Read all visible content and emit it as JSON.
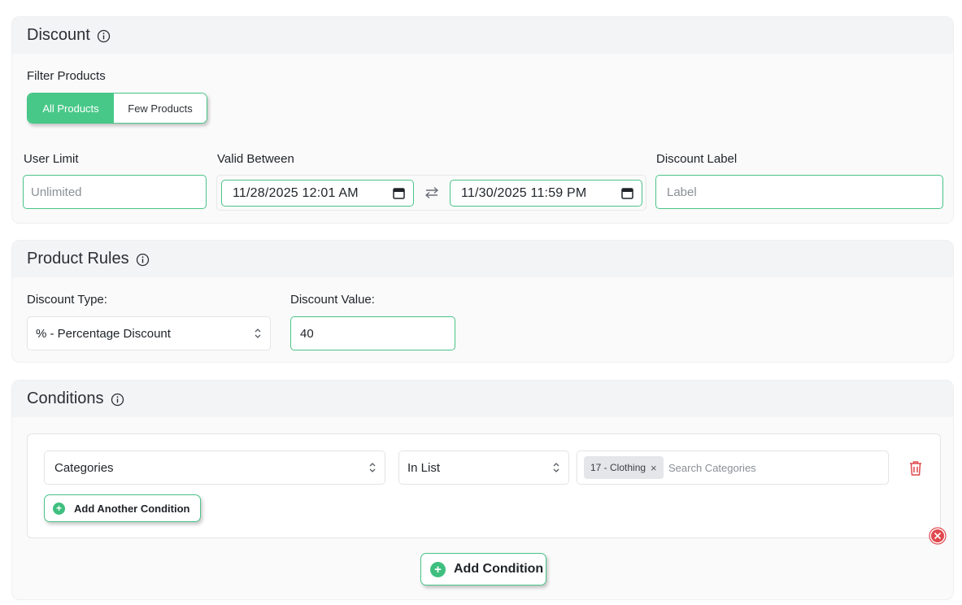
{
  "discount": {
    "title": "Discount",
    "filter_label": "Filter Products",
    "filter_options": [
      "All Products",
      "Few Products"
    ],
    "user_limit_label": "User Limit",
    "user_limit_placeholder": "Unlimited",
    "valid_between_label": "Valid Between",
    "start_datetime": "11/28/2025 12:01 AM",
    "end_datetime": "11/30/2025 11:59 PM",
    "discount_label_label": "Discount Label",
    "discount_label_placeholder": "Label"
  },
  "product_rules": {
    "title": "Product Rules",
    "discount_type_label": "Discount Type:",
    "discount_type_value": "% - Percentage Discount",
    "discount_value_label": "Discount Value:",
    "discount_value": "40"
  },
  "conditions": {
    "title": "Conditions",
    "field_value": "Categories",
    "operator_value": "In List",
    "tags": [
      "17 - Clothing"
    ],
    "search_placeholder": "Search Categories",
    "add_another_label": "Add Another Condition",
    "add_condition_label": "Add Condition"
  },
  "colors": {
    "accent": "#48c888",
    "danger": "#e0484e"
  },
  "icons": [
    "info-icon",
    "calendar-icon",
    "swap-icon",
    "chevron-updown-icon",
    "trash-icon",
    "plus-circle-icon",
    "close-circle-icon"
  ]
}
